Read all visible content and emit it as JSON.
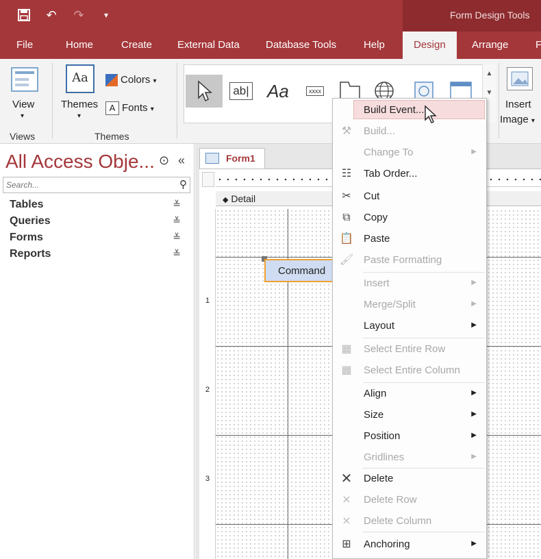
{
  "qat": {
    "save_icon": "save-icon",
    "undo_icon": "undo-icon",
    "redo_icon": "redo-icon",
    "customize_icon": "customize-qat-icon"
  },
  "contextual_title": "Form Design Tools",
  "tabs": [
    {
      "label": "File"
    },
    {
      "label": "Home"
    },
    {
      "label": "Create"
    },
    {
      "label": "External Data"
    },
    {
      "label": "Database Tools"
    },
    {
      "label": "Help"
    },
    {
      "label": "Design"
    },
    {
      "label": "Arrange"
    },
    {
      "label": "F"
    }
  ],
  "ribbon": {
    "view_label": "View",
    "themes_label": "Themes",
    "colors_label": "Colors",
    "fonts_label": "Fonts",
    "views_group": "Views",
    "themes_group": "Themes",
    "textbox_glyph": "ab|",
    "label_glyph": "Aa",
    "button_glyph": "xxxx",
    "insert_image_label_1": "Insert",
    "insert_image_label_2": "Image"
  },
  "nav": {
    "title": "All Access Obje...",
    "search_placeholder": "Search...",
    "groups": [
      {
        "label": "Tables"
      },
      {
        "label": "Queries"
      },
      {
        "label": "Forms"
      },
      {
        "label": "Reports"
      }
    ]
  },
  "document": {
    "tab_label": "Form1",
    "section_label": "Detail",
    "ruler_marks": [
      "1",
      "2",
      "3"
    ],
    "command_button_text": "Command"
  },
  "context_menu": {
    "items": [
      {
        "label": "Build Event...",
        "state": "highlighted"
      },
      {
        "label": "Build...",
        "state": "disabled",
        "icon": "build-icon"
      },
      {
        "label": "Change To",
        "state": "disabled",
        "submenu": true
      },
      {
        "label": "Tab Order...",
        "icon": "tab-order-icon"
      },
      {
        "label": "Cut",
        "icon": "cut-icon"
      },
      {
        "label": "Copy",
        "icon": "copy-icon"
      },
      {
        "label": "Paste",
        "icon": "paste-icon"
      },
      {
        "label": "Paste Formatting",
        "state": "disabled",
        "icon": "paste-formatting-icon"
      },
      {
        "label": "Insert",
        "state": "disabled",
        "submenu": true
      },
      {
        "label": "Merge/Split",
        "state": "disabled",
        "submenu": true
      },
      {
        "label": "Layout",
        "submenu": true
      },
      {
        "label": "Select Entire Row",
        "state": "disabled",
        "icon": "select-row-icon"
      },
      {
        "label": "Select Entire Column",
        "state": "disabled",
        "icon": "select-column-icon"
      },
      {
        "label": "Align",
        "submenu": true
      },
      {
        "label": "Size",
        "submenu": true
      },
      {
        "label": "Position",
        "submenu": true
      },
      {
        "label": "Gridlines",
        "state": "disabled",
        "submenu": true
      },
      {
        "label": "Delete",
        "icon": "delete-icon"
      },
      {
        "label": "Delete Row",
        "state": "disabled",
        "icon": "delete-row-icon"
      },
      {
        "label": "Delete Column",
        "state": "disabled",
        "icon": "delete-column-icon"
      },
      {
        "label": "Anchoring",
        "submenu": true,
        "icon": "anchoring-icon"
      }
    ]
  },
  "colors": {
    "brand": "#a4373a",
    "highlight": "#f6dcdd",
    "selection_border": "#f0a030"
  }
}
